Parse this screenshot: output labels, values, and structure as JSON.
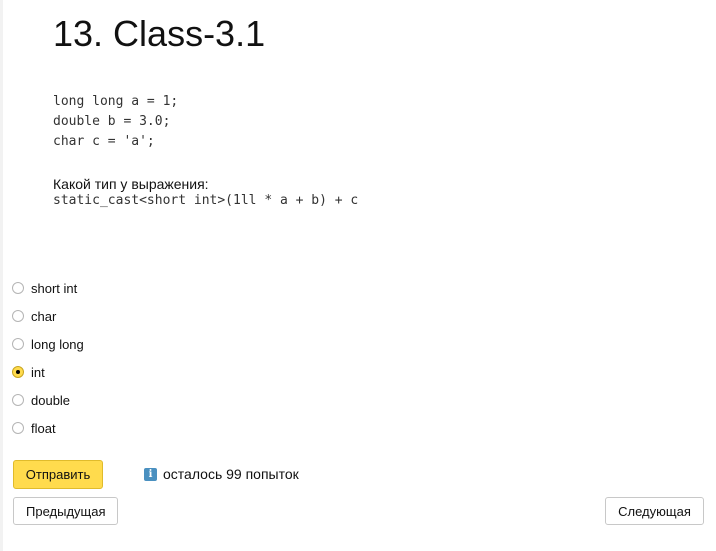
{
  "task": {
    "title": "13. Class-3.1",
    "code_lines": "long long a = 1;\ndouble b = 3.0;\nchar c = 'a';",
    "question": "Какой тип у выражения:",
    "expression": "static_cast<short int>(1ll * a + b) + c"
  },
  "options": [
    {
      "label": "short int",
      "selected": false
    },
    {
      "label": "char",
      "selected": false
    },
    {
      "label": "long long",
      "selected": false
    },
    {
      "label": "int",
      "selected": true
    },
    {
      "label": "double",
      "selected": false
    },
    {
      "label": "float",
      "selected": false
    }
  ],
  "actions": {
    "submit_label": "Отправить",
    "attempts_text": "осталось 99 попыток",
    "prev_label": "Предыдущая",
    "next_label": "Следующая"
  },
  "icons": {
    "info": "info-icon"
  },
  "colors": {
    "accent": "#ffdb4d",
    "info": "#4a90c0"
  }
}
